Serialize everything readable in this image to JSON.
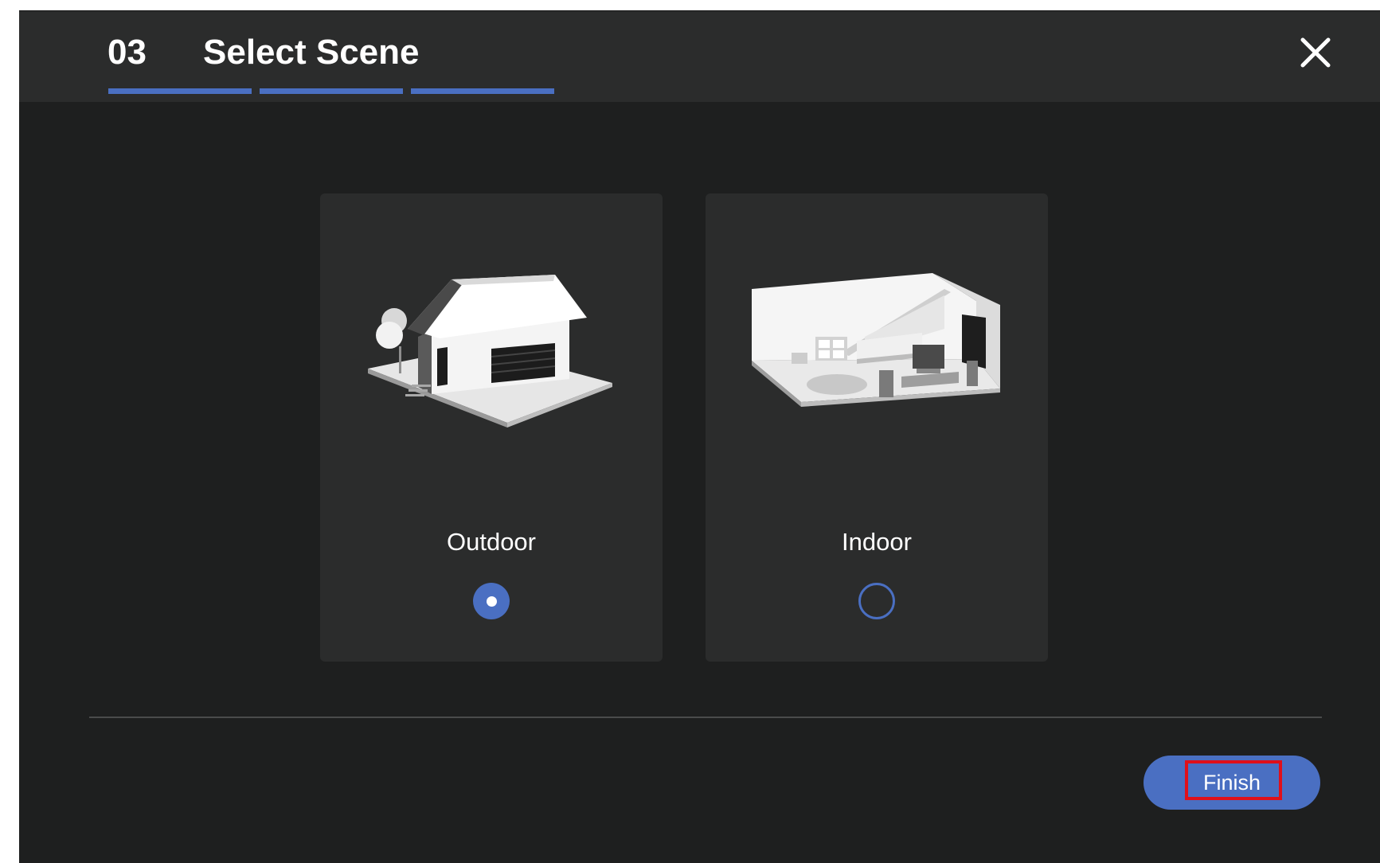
{
  "header": {
    "step_number": "03",
    "title": "Select Scene",
    "progress_steps": 3,
    "progress_completed": 3,
    "close_icon": "close-icon"
  },
  "scenes": [
    {
      "label": "Outdoor",
      "selected": true,
      "illustration": "house-illustration-icon"
    },
    {
      "label": "Indoor",
      "selected": false,
      "illustration": "room-illustration-icon"
    }
  ],
  "footer": {
    "finish_label": "Finish"
  },
  "colors": {
    "accent": "#4a6fc2",
    "background": "#1e1f1f",
    "header": "#2b2c2c",
    "card": "#2b2c2c",
    "highlight": "#e0101a"
  }
}
